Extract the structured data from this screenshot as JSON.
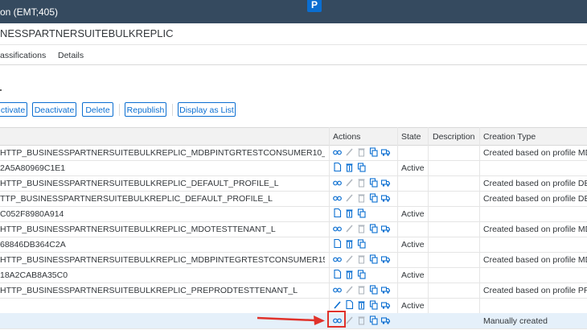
{
  "shell": {
    "title": "on (EMT;405)",
    "logo": "P"
  },
  "object": {
    "title": "NESSPARTNERSUITEBULKREPLIC"
  },
  "tabs": [
    {
      "label": "assifications"
    },
    {
      "label": "Details"
    }
  ],
  "toolbar": {
    "activate": "ctivate",
    "deactivate": "Deactivate",
    "delete": "Delete",
    "republish": "Republish",
    "display_as_list": "Display as List"
  },
  "table": {
    "headers": {
      "actions": "Actions",
      "state": "State",
      "description": "Description",
      "creation_type": "Creation Type"
    },
    "rows": [
      {
        "name": "HTTP_BUSINESSPARTNERSUITEBULKREPLIC_MDBPINTGRTESTCONSUMER10_L",
        "state": "",
        "description": "",
        "creation": "Created based on profile MDB",
        "icons": "profile"
      },
      {
        "name": "2A5A80969C1E1",
        "state": "Active",
        "description": "",
        "creation": "",
        "icons": "version"
      },
      {
        "name": "HTTP_BUSINESSPARTNERSUITEBULKREPLIC_DEFAULT_PROFILE_L",
        "state": "",
        "description": "",
        "creation": "Created based on profile DEFA",
        "icons": "profile"
      },
      {
        "name": "TTP_BUSINESSPARTNERSUITEBULKREPLIC_DEFAULT_PROFILE_L",
        "state": "",
        "description": "",
        "creation": "Created based on profile DEFA",
        "icons": "profile"
      },
      {
        "name": "C052F8980A914",
        "state": "Active",
        "description": "",
        "creation": "",
        "icons": "version"
      },
      {
        "name": "HTTP_BUSINESSPARTNERSUITEBULKREPLIC_MDOTESTTENANT_L",
        "state": "",
        "description": "",
        "creation": "Created based on profile MDO",
        "icons": "profile"
      },
      {
        "name": "68846DB364C2A",
        "state": "Active",
        "description": "",
        "creation": "",
        "icons": "version"
      },
      {
        "name": "HTTP_BUSINESSPARTNERSUITEBULKREPLIC_MDBPINTEGRTESTCONSUMER15_L",
        "state": "",
        "description": "",
        "creation": "Created based on profile MDB",
        "icons": "profile"
      },
      {
        "name": "18A2CAB8A35C0",
        "state": "Active",
        "description": "",
        "creation": "",
        "icons": "version"
      },
      {
        "name": "HTTP_BUSINESSPARTNERSUITEBULKREPLIC_PREPRODTESTTENANT_L",
        "state": "",
        "description": "",
        "creation": "Created based on profile PRE",
        "icons": "profile"
      },
      {
        "name": "",
        "state": "Active",
        "description": "",
        "creation": "",
        "icons": "edit"
      },
      {
        "name": "",
        "state": "",
        "description": "",
        "creation": "Manually created",
        "icons": "profile",
        "selected": true
      }
    ]
  },
  "colors": {
    "shell": "#354a5f",
    "accent": "#0a6ed1",
    "highlight": "#e0322b",
    "selected_row": "#e5f0fa"
  }
}
